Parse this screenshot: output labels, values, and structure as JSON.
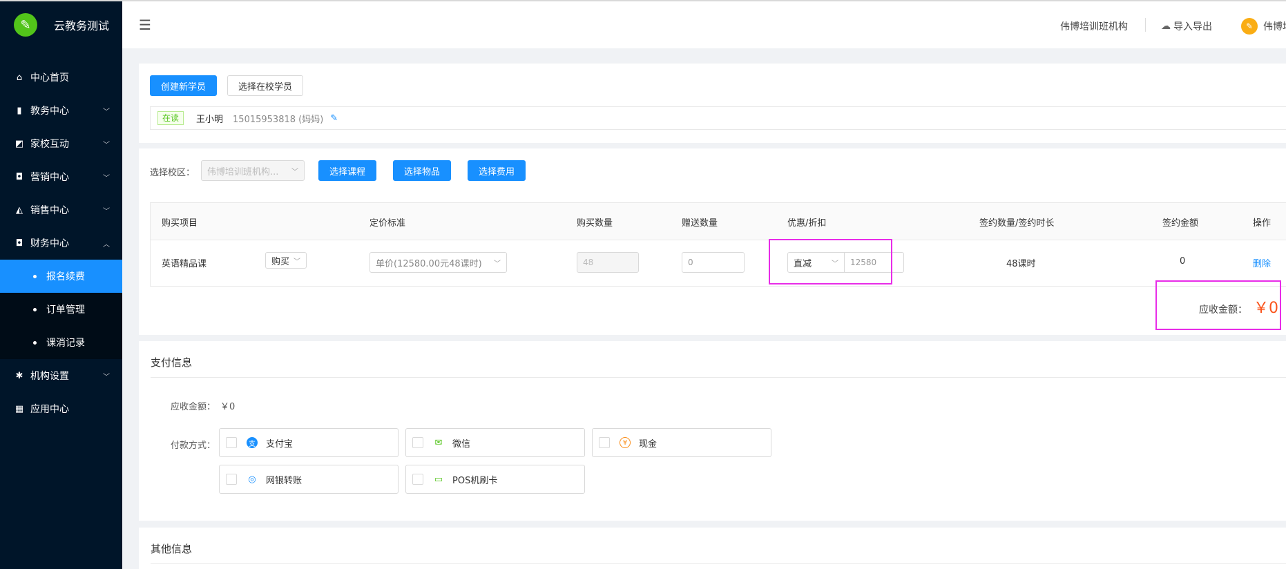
{
  "app": {
    "title": "云教务测试"
  },
  "sidebar": {
    "items": [
      {
        "label": "中心首页",
        "icon": "⌂",
        "has_arrow": false
      },
      {
        "label": "教务中心",
        "icon": "▮",
        "has_arrow": true
      },
      {
        "label": "家校互动",
        "icon": "◩",
        "has_arrow": true
      },
      {
        "label": "营销中心",
        "icon": "◘",
        "has_arrow": true
      },
      {
        "label": "销售中心",
        "icon": "◭",
        "has_arrow": true
      },
      {
        "label": "财务中心",
        "icon": "◘",
        "has_arrow": true,
        "expanded": true
      }
    ],
    "sub_items": [
      {
        "label": "报名续费",
        "active": true
      },
      {
        "label": "订单管理",
        "active": false
      },
      {
        "label": "课消记录",
        "active": false
      }
    ],
    "items_after": [
      {
        "label": "机构设置",
        "icon": "✱",
        "has_arrow": true
      },
      {
        "label": "应用中心",
        "icon": "▦",
        "has_arrow": false
      }
    ]
  },
  "header": {
    "org": "伟博培训班机构",
    "import_export": "导入导出",
    "user": "伟博培"
  },
  "student": {
    "create_button": "创建新学员",
    "select_button": "选择在校学员",
    "status_tag": "在读",
    "name": "王小明",
    "phone": "15015953818 (妈妈)"
  },
  "order": {
    "campus_label": "选择校区：",
    "campus_value": "伟博培训班机构...",
    "select_course": "选择课程",
    "select_goods": "选择物品",
    "select_fee": "选择费用",
    "columns": [
      "购买项目",
      "定价标准",
      "购买数量",
      "赠送数量",
      "优惠/折扣",
      "签约数量/签约时长",
      "签约金额",
      "操作"
    ],
    "rows": [
      {
        "item": "英语精品课",
        "type": "购买",
        "price": "单价(12580.00元48课时)",
        "qty": "48",
        "gift": "0",
        "discount_type": "直减",
        "discount_value": "12580",
        "sign_qty": "48课时",
        "sign_amount": "0",
        "action": "删除"
      }
    ],
    "due_label": "应收金额：",
    "due_amount": "￥0"
  },
  "payment": {
    "title": "支付信息",
    "due_label": "应收金额：",
    "due_value": "￥0",
    "method_label": "付款方式：",
    "methods": [
      {
        "label": "支付宝",
        "color": "#1890ff",
        "glyph": "支"
      },
      {
        "label": "微信",
        "color": "#52c41a",
        "glyph": "✉"
      },
      {
        "label": "现金",
        "color": "#fa8c16",
        "glyph": "¥"
      },
      {
        "label": "网银转账",
        "color": "#1890ff",
        "glyph": "◎"
      },
      {
        "label": "POS机刷卡",
        "color": "#52c41a",
        "glyph": "▭"
      }
    ]
  },
  "other": {
    "title": "其他信息"
  },
  "colors": {
    "primary": "#1890ff",
    "sidebar": "#001529",
    "highlight": "#e82ce8",
    "amount": "#fa541c"
  }
}
